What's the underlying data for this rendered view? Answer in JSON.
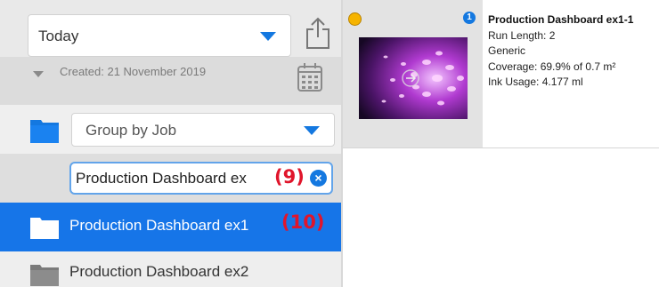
{
  "filter": {
    "date_range": "Today"
  },
  "created_label": "Created: 21 November 2019",
  "group": {
    "label": "Group by Job"
  },
  "rename": {
    "value": "Production Dashboard ex",
    "annotation": "(9)"
  },
  "folders": [
    {
      "name": "Production Dashboard ex1",
      "annotation": "(10)",
      "selected": true
    },
    {
      "name": "Production Dashboard ex2",
      "selected": false
    }
  ],
  "job_card": {
    "title": "Production Dashboard ex1-1",
    "badge": "1",
    "run_length": "Run Length: 2",
    "media": "Generic",
    "coverage": "Coverage: 69.9% of 0.7 m²",
    "ink_usage": "Ink Usage: 4.177 ml"
  },
  "colors": {
    "accent": "#1478e0",
    "selected_row": "#1675e8",
    "annotation_red": "#e0152b",
    "status_yellow": "#f6b400"
  },
  "icons": [
    "share-icon",
    "calendar-icon",
    "folder-icon",
    "clear-icon",
    "chevron-down-icon",
    "arrow-right-icon"
  ]
}
